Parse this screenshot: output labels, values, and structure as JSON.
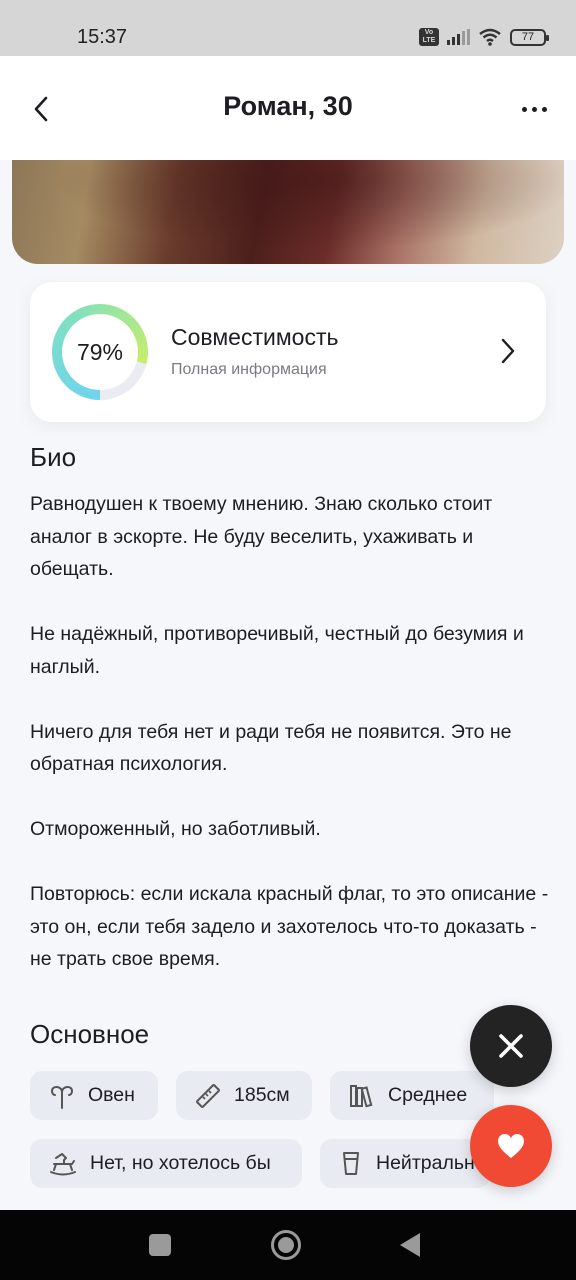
{
  "status_bar": {
    "time": "15:37",
    "volte": "Vo LTE",
    "battery": "77"
  },
  "header": {
    "title": "Роман, 30"
  },
  "compatibility": {
    "percent_label": "79%",
    "percent_value": 79,
    "title": "Совместимость",
    "subtitle": "Полная информация",
    "ring_colors": [
      "#6fd3f0",
      "#7fe0c0",
      "#c7ee6b"
    ]
  },
  "bio": {
    "title": "Био",
    "paragraphs": [
      "Равнодушен к твоему мнению. Знаю сколько стоит аналог в эскорте. Не буду веселить, ухаживать и обещать.",
      "Не надёжный, противоречивый, честный до безумия и наглый.",
      "Ничего для тебя нет и ради тебя не появится. Это не обратная психология.",
      "Отмороженный, но заботливый.",
      "Повторюсь: если искала красный флаг, то это описание - это он, если тебя задело и захотелось что-то доказать - не трать свое время."
    ]
  },
  "basics": {
    "title": "Основное",
    "chips": [
      {
        "icon": "aries-icon",
        "label": "Овен"
      },
      {
        "icon": "ruler-icon",
        "label": "185см"
      },
      {
        "icon": "books-icon",
        "label": "Среднее"
      },
      {
        "icon": "rocking-horse-icon",
        "label": "Нет, но хотелось бы"
      },
      {
        "icon": "glass-icon",
        "label": "Нейтрально"
      }
    ]
  },
  "actions": {
    "dislike_icon": "close-icon",
    "like_icon": "heart-icon",
    "like_color": "#f04a35",
    "dislike_color": "#232323"
  }
}
